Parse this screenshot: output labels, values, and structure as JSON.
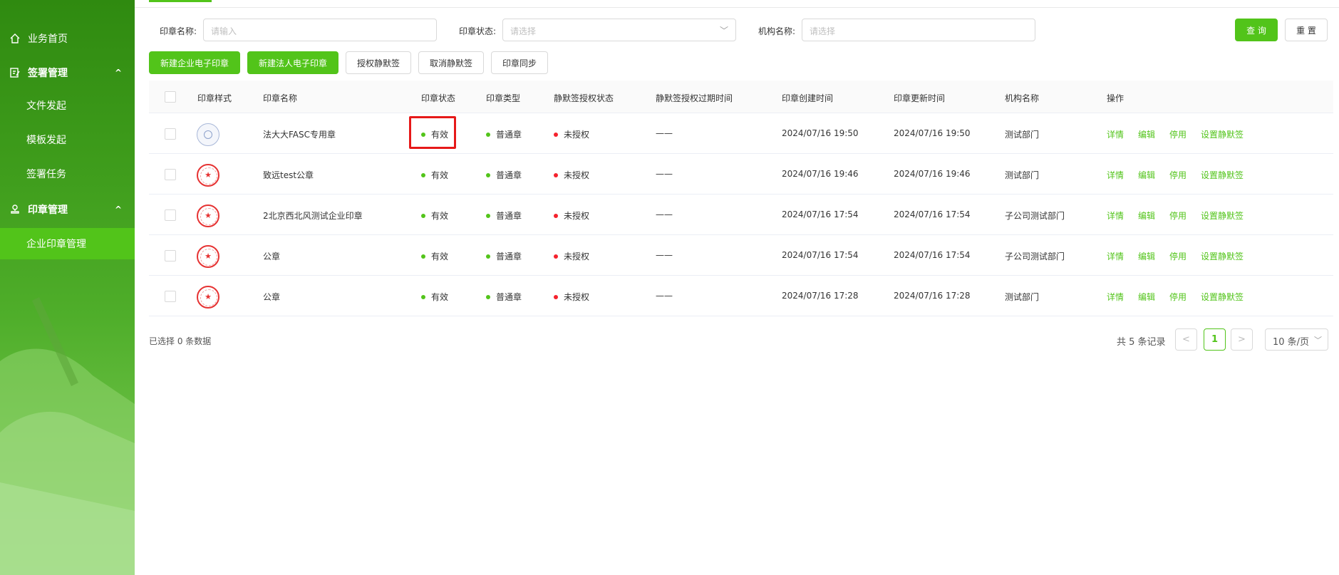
{
  "sidebar": {
    "items": [
      {
        "label": "业务首页",
        "icon": "home-icon"
      },
      {
        "label": "签署管理",
        "icon": "sign-doc-icon",
        "chevron": "^"
      },
      {
        "label": "文件发起"
      },
      {
        "label": "模板发起"
      },
      {
        "label": "签署任务"
      },
      {
        "label": "印章管理",
        "icon": "stamp-icon",
        "chevron": "^"
      },
      {
        "label": "企业印章管理"
      }
    ]
  },
  "filters": {
    "name_label": "印章名称:",
    "name_placeholder": "请输入",
    "status_label": "印章状态:",
    "status_placeholder": "请选择",
    "org_label": "机构名称:",
    "org_placeholder": "请选择",
    "query_label": "查 询",
    "reset_label": "重 置"
  },
  "toolbar": {
    "new_company_seal": "新建企业电子印章",
    "new_legal_seal": "新建法人电子印章",
    "authorize_silent": "授权静默签",
    "cancel_silent": "取消静默签",
    "sync_seal": "印章同步"
  },
  "table": {
    "columns": [
      "印章样式",
      "印章名称",
      "印章状态",
      "印章类型",
      "静默签授权状态",
      "静默签授权过期时间",
      "印章创建时间",
      "印章更新时间",
      "机构名称",
      "操作"
    ],
    "rows": [
      {
        "seal_style": "blue",
        "name": "法大大FASC专用章",
        "status": "有效",
        "type": "普通章",
        "auth_status": "未授权",
        "auth_expire": "——",
        "created": "2024/07/16 19:50",
        "updated": "2024/07/16 19:50",
        "org": "测试部门"
      },
      {
        "seal_style": "red",
        "name": "致远test公章",
        "status": "有效",
        "type": "普通章",
        "auth_status": "未授权",
        "auth_expire": "——",
        "created": "2024/07/16 19:46",
        "updated": "2024/07/16 19:46",
        "org": "测试部门"
      },
      {
        "seal_style": "red",
        "name": "2北京西北风测试企业印章",
        "status": "有效",
        "type": "普通章",
        "auth_status": "未授权",
        "auth_expire": "——",
        "created": "2024/07/16 17:54",
        "updated": "2024/07/16 17:54",
        "org": "子公司测试部门"
      },
      {
        "seal_style": "red",
        "name": "公章",
        "status": "有效",
        "type": "普通章",
        "auth_status": "未授权",
        "auth_expire": "——",
        "created": "2024/07/16 17:54",
        "updated": "2024/07/16 17:54",
        "org": "子公司测试部门"
      },
      {
        "seal_style": "red",
        "name": "公章",
        "status": "有效",
        "type": "普通章",
        "auth_status": "未授权",
        "auth_expire": "——",
        "created": "2024/07/16 17:28",
        "updated": "2024/07/16 17:28",
        "org": "测试部门"
      }
    ],
    "actions": [
      "详情",
      "编辑",
      "停用",
      "设置静默签"
    ]
  },
  "footer": {
    "selected_info": "已选择 0 条数据",
    "total": "共 5 条记录",
    "prev": "<",
    "current_page": "1",
    "next": ">",
    "page_size": "10 条/页"
  },
  "colors": {
    "accent": "#52c41a",
    "sidebar_dark": "#2f8a10",
    "status_valid": "#52c41a",
    "status_unauthorized": "#f5222d",
    "highlight": "#e61919"
  }
}
